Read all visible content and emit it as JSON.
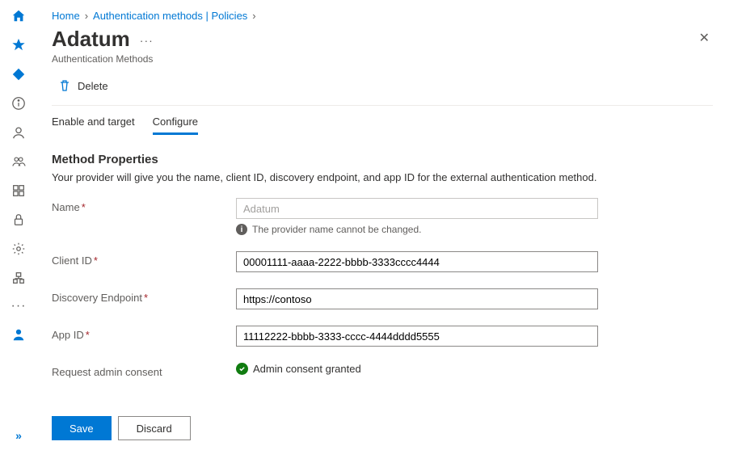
{
  "breadcrumb": {
    "home": "Home",
    "policies": "Authentication methods | Policies"
  },
  "header": {
    "title": "Adatum",
    "subtitle": "Authentication Methods"
  },
  "toolbar": {
    "delete": "Delete"
  },
  "tabs": {
    "enable_target": "Enable and target",
    "configure": "Configure"
  },
  "section": {
    "title": "Method Properties",
    "description": "Your provider will give you the name, client ID, discovery endpoint, and app ID for the external authentication method."
  },
  "form": {
    "name_label": "Name",
    "name_value": "Adatum",
    "name_info": "The provider name cannot be changed.",
    "client_id_label": "Client ID",
    "client_id_value": "00001111-aaaa-2222-bbbb-3333cccc4444",
    "discovery_label": "Discovery Endpoint",
    "discovery_value": "https://contoso",
    "app_id_label": "App ID",
    "app_id_value": "11112222-bbbb-3333-cccc-4444dddd5555",
    "consent_label": "Request admin consent",
    "consent_status": "Admin consent granted"
  },
  "footer": {
    "save": "Save",
    "discard": "Discard"
  }
}
